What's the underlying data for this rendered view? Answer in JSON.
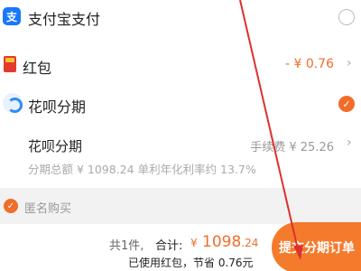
{
  "payment": {
    "alipay": {
      "icon": "alipay-icon",
      "icon_char": "支",
      "label": "支付宝支付"
    },
    "hongbao": {
      "icon": "red-packet-icon",
      "label": "红包",
      "amount": "- ¥ 0.76"
    },
    "huabei": {
      "icon": "huabei-icon",
      "label": "花呗分期"
    },
    "plan": {
      "label": "花呗分期",
      "fee": "手续费 ¥ 25.26",
      "description": "分期总额 ¥ 1098.24 单利年化利率约 13.7%"
    },
    "anonymous": {
      "label": "匿名购买"
    }
  },
  "footer": {
    "count": "共1件,",
    "total_label": "合计:",
    "currency": "¥",
    "total_int": "1098",
    "total_dec": ".24",
    "savings": "已使用红包，节省 0.76元",
    "submit_label": "提交分期订单"
  },
  "colors": {
    "accent": "#f06d2a",
    "alipay_blue": "#1677ff",
    "annotation_red": "#e0302a"
  }
}
